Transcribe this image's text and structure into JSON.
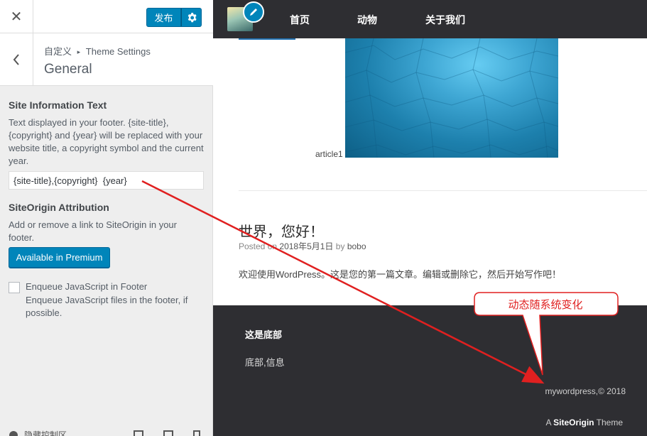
{
  "customizer": {
    "close_icon": "close-icon",
    "publish_label": "发布",
    "breadcrumb_root": "自定义",
    "breadcrumb_sep": "▸",
    "breadcrumb_parent": "Theme Settings",
    "section_title": "General",
    "site_info": {
      "title": "Site Information Text",
      "description": "Text displayed in your footer. {site-title}, {copyright} and {year} will be replaced with your website title, a copyright symbol and the current year.",
      "value": "{site-title},{copyright}  {year}"
    },
    "attribution": {
      "title": "SiteOrigin Attribution",
      "description": "Add or remove a link to SiteOrigin in your footer.",
      "button_label": "Available in Premium"
    },
    "enqueue": {
      "label": "Enqueue JavaScript in Footer",
      "description": "Enqueue JavaScript files in the footer, if possible.",
      "checked": false
    },
    "footer": {
      "hide_label": "隐藏控制区"
    }
  },
  "preview": {
    "nav": {
      "items": [
        "首页",
        "动物",
        "关于我们"
      ]
    },
    "article": {
      "caption": "article1"
    },
    "post": {
      "title": "世界，您好！",
      "meta_posted": "Posted on",
      "meta_date": "2018年5月1日",
      "meta_by": "by",
      "meta_author": "bobo",
      "excerpt": "欢迎使用WordPress。这是您的第一篇文章。编辑或删除它，然后开始写作吧！"
    },
    "footer": {
      "title": "这是底部",
      "text": "底部,信息",
      "copyright": "mywordpress,© 2018",
      "credit_prefix": "A",
      "credit_brand": "SiteOrigin",
      "credit_suffix": "Theme"
    }
  },
  "annotation": {
    "callout_text": "动态随系统变化",
    "color": "#e02020"
  },
  "colors": {
    "accent": "#0085ba",
    "dark_bg": "#2e2e32",
    "panel_bg": "#eeeeee"
  }
}
